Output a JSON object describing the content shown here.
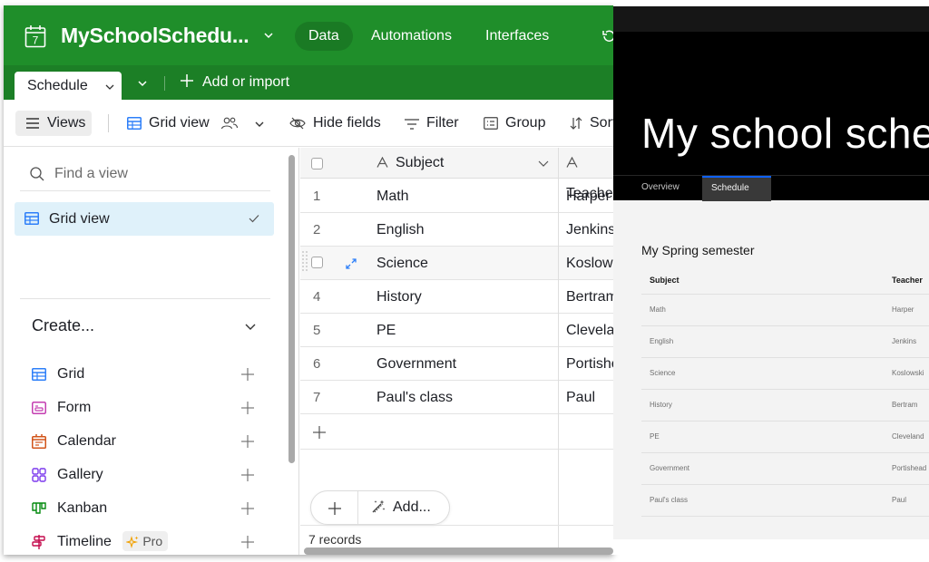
{
  "airtable": {
    "base_title": "MySchoolSchedu...",
    "nav": {
      "data": "Data",
      "automations": "Automations",
      "interfaces": "Interfaces"
    },
    "tabs": {
      "active": "Schedule",
      "add_or_import": "Add or import"
    },
    "toolbar": {
      "views": "Views",
      "grid_view": "Grid view",
      "hide_fields": "Hide fields",
      "filter": "Filter",
      "group": "Group",
      "sort": "Sort"
    },
    "sidebar": {
      "search_placeholder": "Find a view",
      "active_view": "Grid view",
      "create_label": "Create...",
      "create_items": [
        {
          "label": "Grid",
          "icon": "grid-icon",
          "color": "#2d7ff9"
        },
        {
          "label": "Form",
          "icon": "form-icon",
          "color": "#c43eb1"
        },
        {
          "label": "Calendar",
          "icon": "calendar-icon",
          "color": "#d2541a"
        },
        {
          "label": "Gallery",
          "icon": "gallery-icon",
          "color": "#7c39ed"
        },
        {
          "label": "Kanban",
          "icon": "kanban-icon",
          "color": "#048a0e"
        },
        {
          "label": "Timeline",
          "icon": "timeline-icon",
          "color": "#c4094c",
          "badge": "Pro"
        }
      ]
    },
    "grid": {
      "columns": [
        "Subject",
        "Teacher"
      ],
      "rows": [
        {
          "num": "1",
          "subject": "Math",
          "teacher": "Harper"
        },
        {
          "num": "2",
          "subject": "English",
          "teacher": "Jenkins"
        },
        {
          "num": "3",
          "subject": "Science",
          "teacher": "Koslowski"
        },
        {
          "num": "4",
          "subject": "History",
          "teacher": "Bertram"
        },
        {
          "num": "5",
          "subject": "PE",
          "teacher": "Cleveland"
        },
        {
          "num": "6",
          "subject": "Government",
          "teacher": "Portishead"
        },
        {
          "num": "7",
          "subject": "Paul's class",
          "teacher": "Paul"
        }
      ],
      "add_label": "Add...",
      "record_count": "7 records"
    },
    "colors": {
      "topbar": "#1f8e2a",
      "tabbar": "#1c7f26",
      "selected_view": "#dff1fa"
    }
  },
  "interface": {
    "title": "My school schedule",
    "tabs": [
      "Overview",
      "Schedule"
    ],
    "active_tab": "Schedule",
    "section_title": "My Spring semester",
    "table": {
      "headers": [
        "Subject",
        "Teacher"
      ],
      "rows": [
        [
          "Math",
          "Harper"
        ],
        [
          "English",
          "Jenkins"
        ],
        [
          "Science",
          "Koslowski"
        ],
        [
          "History",
          "Bertram"
        ],
        [
          "PE",
          "Cleveland"
        ],
        [
          "Government",
          "Portishead"
        ],
        [
          "Paul's class",
          "Paul"
        ]
      ]
    },
    "colors": {
      "hero": "#000000",
      "tab_indicator": "#0f62fe"
    }
  }
}
